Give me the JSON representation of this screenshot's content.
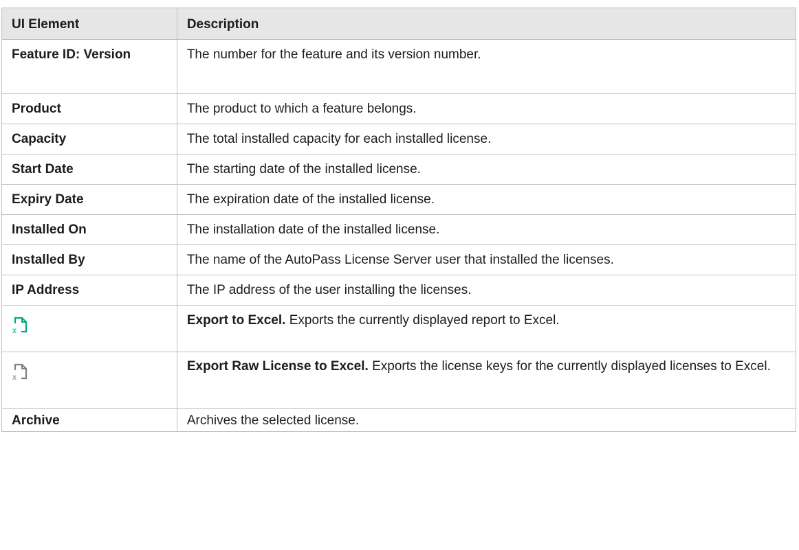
{
  "table": {
    "headers": {
      "element": "UI Element",
      "description": "Description"
    },
    "rows": [
      {
        "element": "Feature ID: Version",
        "description": "The number for the feature and its version number."
      },
      {
        "element": "Product",
        "description": "The product to which a feature belongs."
      },
      {
        "element": "Capacity",
        "description": "The total installed capacity for each installed license."
      },
      {
        "element": "Start Date",
        "description": "The starting date of the installed license."
      },
      {
        "element": "Expiry Date",
        "description": "The expiration date of the installed license."
      },
      {
        "element": "Installed On",
        "description": "The installation date of the installed license."
      },
      {
        "element": "Installed By",
        "description": "The name of the AutoPass License Server user that installed the licenses."
      },
      {
        "element": "IP Address",
        "description": "The IP address of the user installing the licenses."
      },
      {
        "icon": "export-excel-icon",
        "icon_color": "#01a982",
        "description_bold": "Export to Excel.",
        "description": " Exports the currently displayed report to Excel."
      },
      {
        "icon": "export-raw-excel-icon",
        "icon_color": "#808080",
        "description_bold": "Export Raw License to Excel.",
        "description": " Exports the license keys for the currently displayed licenses to Excel."
      },
      {
        "element": "Archive",
        "description": "Archives the selected license."
      }
    ]
  }
}
